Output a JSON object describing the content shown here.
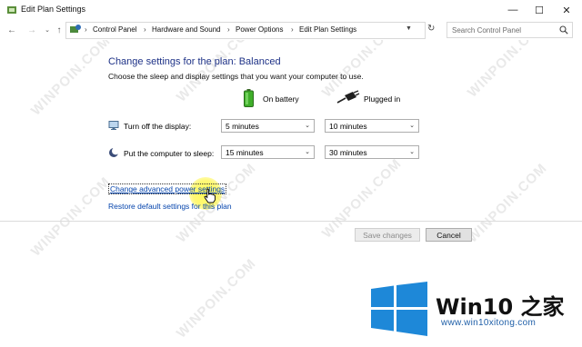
{
  "window": {
    "title": "Edit Plan Settings",
    "minimize": "—",
    "maximize": "☐",
    "close": "✕"
  },
  "address": {
    "breadcrumbs": [
      "Control Panel",
      "Hardware and Sound",
      "Power Options",
      "Edit Plan Settings"
    ],
    "search_placeholder": "Search Control Panel"
  },
  "page": {
    "heading": "Change settings for the plan: Balanced",
    "subheading": "Choose the sleep and display settings that you want your computer to use.",
    "columns": {
      "battery": "On battery",
      "plugged": "Plugged in"
    },
    "settings": [
      {
        "label": "Turn off the display:",
        "icon": "monitor-icon",
        "battery": "5 minutes",
        "plugged": "10 minutes"
      },
      {
        "label": "Put the computer to sleep:",
        "icon": "moon-icon",
        "battery": "15 minutes",
        "plugged": "30 minutes"
      }
    ],
    "advanced_link": "Change advanced power settings",
    "restore_link": "Restore default settings for this plan"
  },
  "buttons": {
    "save": "Save changes",
    "cancel": "Cancel"
  },
  "watermark": {
    "text": "WINPOIN.COM"
  },
  "logo": {
    "text": "Win10 之家",
    "url": "www.win10xitong.com"
  },
  "colors": {
    "heading": "#1e3287",
    "link": "#0645ad",
    "highlight": "#fff350",
    "logo_blue": "#1e88d8"
  }
}
